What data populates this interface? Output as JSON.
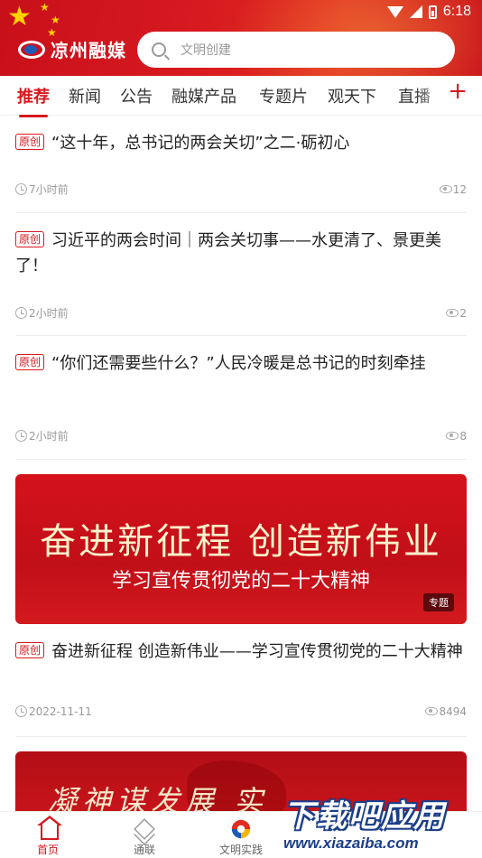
{
  "status_bar": {
    "time": "6:18"
  },
  "header": {
    "logo_text": "凉州融媒",
    "search": {
      "placeholder": "文明创建"
    }
  },
  "tabs": [
    {
      "label": "推荐",
      "active": true
    },
    {
      "label": "新闻",
      "active": false
    },
    {
      "label": "公告",
      "active": false
    },
    {
      "label": "融媒产品",
      "active": false
    },
    {
      "label": "专题片",
      "active": false
    },
    {
      "label": "观天下",
      "active": false
    },
    {
      "label": "直播",
      "active": false
    }
  ],
  "tab_add_label": "+",
  "feed": [
    {
      "tag": "原创",
      "title": "“这十年，总书记的两会关切”之二·砺初心",
      "time": "7小时前",
      "views": "12"
    },
    {
      "tag": "原创",
      "title": "习近平的两会时间｜两会关切事——水更清了、景更美了！",
      "time": "2小时前",
      "views": "2"
    },
    {
      "tag": "原创",
      "title": "“你们还需要些什么？”人民冷暖是总书记的时刻牵挂",
      "time": "2小时前",
      "views": "8"
    },
    {
      "banner": {
        "main": "奋进新征程  创造新伟业",
        "sub": "学习宣传贯彻党的二十大精神",
        "badge": "专题"
      },
      "tag": "原创",
      "title": "奋进新征程 创造新伟业——学习宣传贯彻党的二十大精神",
      "time": "2022-11-11",
      "views": "8494"
    }
  ],
  "banner2": {
    "text": "凝神谋发展  实"
  },
  "bottom_nav": [
    {
      "label": "首页",
      "icon": "home-icon",
      "active": true
    },
    {
      "label": "通联",
      "icon": "layers-icon",
      "active": false
    },
    {
      "label": "文明实践",
      "icon": "practice-logo-icon",
      "active": false
    }
  ],
  "watermark": {
    "main": "下载吧应用",
    "url": "www.xiazaiba.com"
  },
  "colors": {
    "brand_red": "#d71920",
    "text": "#222222",
    "meta": "#999999"
  }
}
